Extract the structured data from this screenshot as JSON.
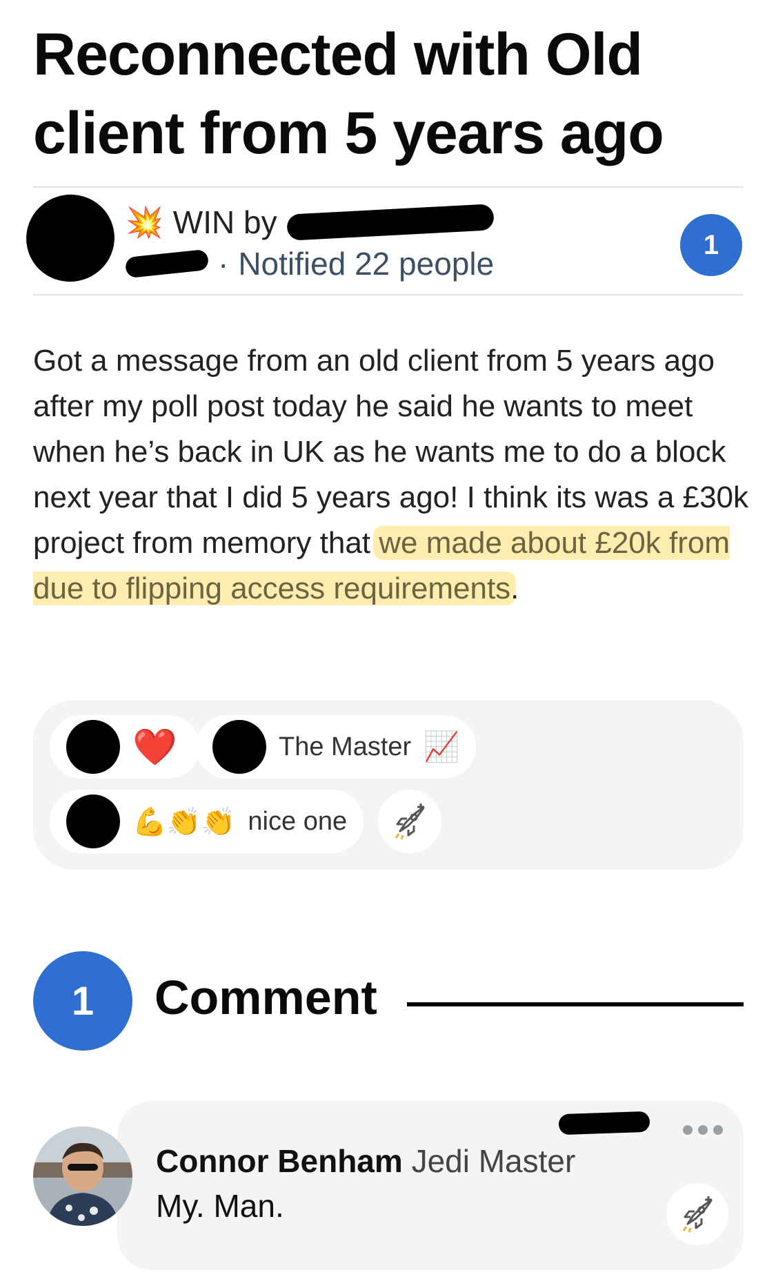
{
  "post": {
    "title": "Reconnected with Old client from 5 years ago",
    "tag_label": "WIN by",
    "notified": "Notified 22 people",
    "separator": "·",
    "unread_count": "1",
    "body_before_highlight": "Got a message from an old client from 5 years ago after my poll post today he said he wants to meet when he’s back in UK as he wants me to do a block next year that I did 5 years ago! I think its was a £30k project from memory that ",
    "body_highlight": "we made about £20k from due to flipping access requirements",
    "body_after_highlight": "."
  },
  "reactions": {
    "items": [
      {
        "emoji": "❤️",
        "label": ""
      },
      {
        "emoji": "📈",
        "label": "The Master"
      },
      {
        "emoji": "💪👏👏",
        "label": "nice one"
      }
    ],
    "add_reaction_icon": "rocket-plus-icon"
  },
  "comments": {
    "count": "1",
    "heading": "Comment",
    "items": [
      {
        "author": "Connor Benham",
        "role": "Jedi Master",
        "text": "My. Man."
      }
    ]
  },
  "colors": {
    "accent": "#2f6fd1",
    "highlight": "#ffdd6e",
    "card_bg": "#f4f4f4"
  }
}
